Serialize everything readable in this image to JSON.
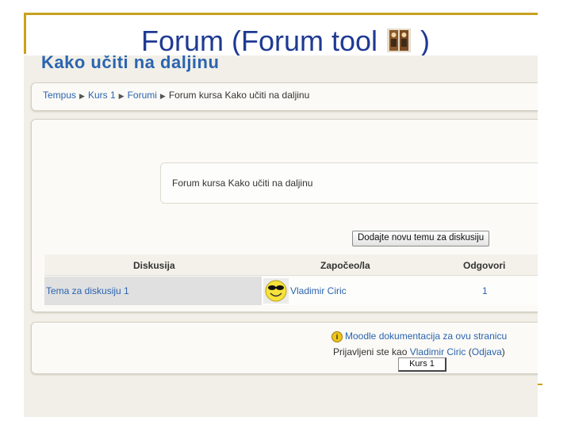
{
  "slide": {
    "title_prefix": "Forum (Forum tool",
    "title_suffix": ")",
    "icon": "forum-people-icon"
  },
  "screen": {
    "course_heading": "Kako učiti na daljinu",
    "breadcrumb": {
      "items": [
        "Tempus",
        "Kurs 1",
        "Forumi"
      ],
      "separator": "▶",
      "current": "Forum kursa Kako učiti na daljinu"
    },
    "forum_intro": "Forum kursa Kako učiti na daljinu",
    "add_topic_button": "Dodajte novu temu za diskusiju",
    "table": {
      "columns": [
        "Diskusija",
        "Započeo/la",
        "Odgovori"
      ],
      "rows": [
        {
          "topic": "Tema za diskusiju 1",
          "author": "Vladimir Ciric",
          "replies": "1",
          "avatar": "smiley-avatar-icon"
        }
      ]
    },
    "footer": {
      "docs_link": "Moodle dokumentacija za ovu stranicu",
      "logged_in_prefix": "Prijavljeni ste kao",
      "user_link": "Vladimir Ciric",
      "logout_open": "(",
      "logout_link": "Odjava",
      "logout_close": ")",
      "course_button": "Kurs 1"
    }
  },
  "colors": {
    "accent_gold": "#c8a21e",
    "title_blue": "#1f3a93",
    "link_blue": "#2b64b0",
    "page_background": "#f1efe7"
  }
}
